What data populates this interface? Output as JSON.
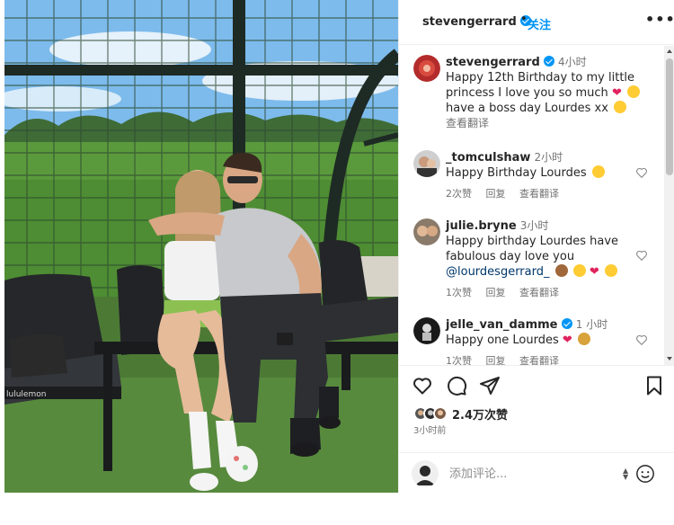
{
  "post": {
    "author": "stevengerrard",
    "follow_label": "关注",
    "more_label": "•••",
    "dot": "•"
  },
  "caption": {
    "username": "stevengerrard",
    "time": "4小时",
    "text": "Happy 12th Birthday to my little princess I love you so much",
    "text_tail": "have a boss day Lourdes xx",
    "translate": "查看翻译"
  },
  "comments": [
    {
      "username": "_tomculshaw",
      "time": "2小时",
      "text": "Happy Birthday Lourdes",
      "likes": "2次赞",
      "reply": "回复",
      "translate": "查看翻译"
    },
    {
      "username": "julie.bryne",
      "time": "3小时",
      "text_1": "Happy birthday Lourdes have",
      "text_2": "fabulous day love you",
      "mention": "@lourdesgerrard_",
      "likes": "1次赞",
      "reply": "回复",
      "translate": "查看翻译"
    },
    {
      "username": "jelle_van_damme",
      "time": "1 小时",
      "text": "Happy one Lourdes",
      "likes": "1次赞",
      "reply": "回复",
      "translate": "查看翻译"
    }
  ],
  "actions": {
    "icons": [
      "heart-icon",
      "comment-icon",
      "share-icon",
      "bookmark-icon"
    ],
    "likes": "2.4万次赞",
    "posted_ago": "3小时前"
  },
  "comment_box": {
    "placeholder": "添加评论...",
    "spinner": "▲▼"
  },
  "colors": {
    "accent": "#0095f6",
    "text": "#262626",
    "muted": "#737373",
    "heart": "#ed4956"
  }
}
